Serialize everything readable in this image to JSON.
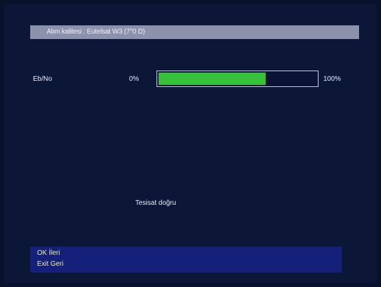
{
  "header": {
    "title": "Alım kalitesi : Eutelsat W3 (7°0 D)"
  },
  "signal": {
    "label": "Eb/No",
    "min_label": "0%",
    "max_label": "100%",
    "level": 0.68,
    "bar_color": "#37c03a"
  },
  "status": {
    "text": "Tesisat doğru"
  },
  "footer": {
    "ok_hint": "OK İleri",
    "exit_hint": "Exit Geri"
  },
  "colors": {
    "background": "#0c1636",
    "title_bar": "#8c91ad",
    "footer_bg": "#15207a",
    "footer_text": "#f4f1a0"
  }
}
